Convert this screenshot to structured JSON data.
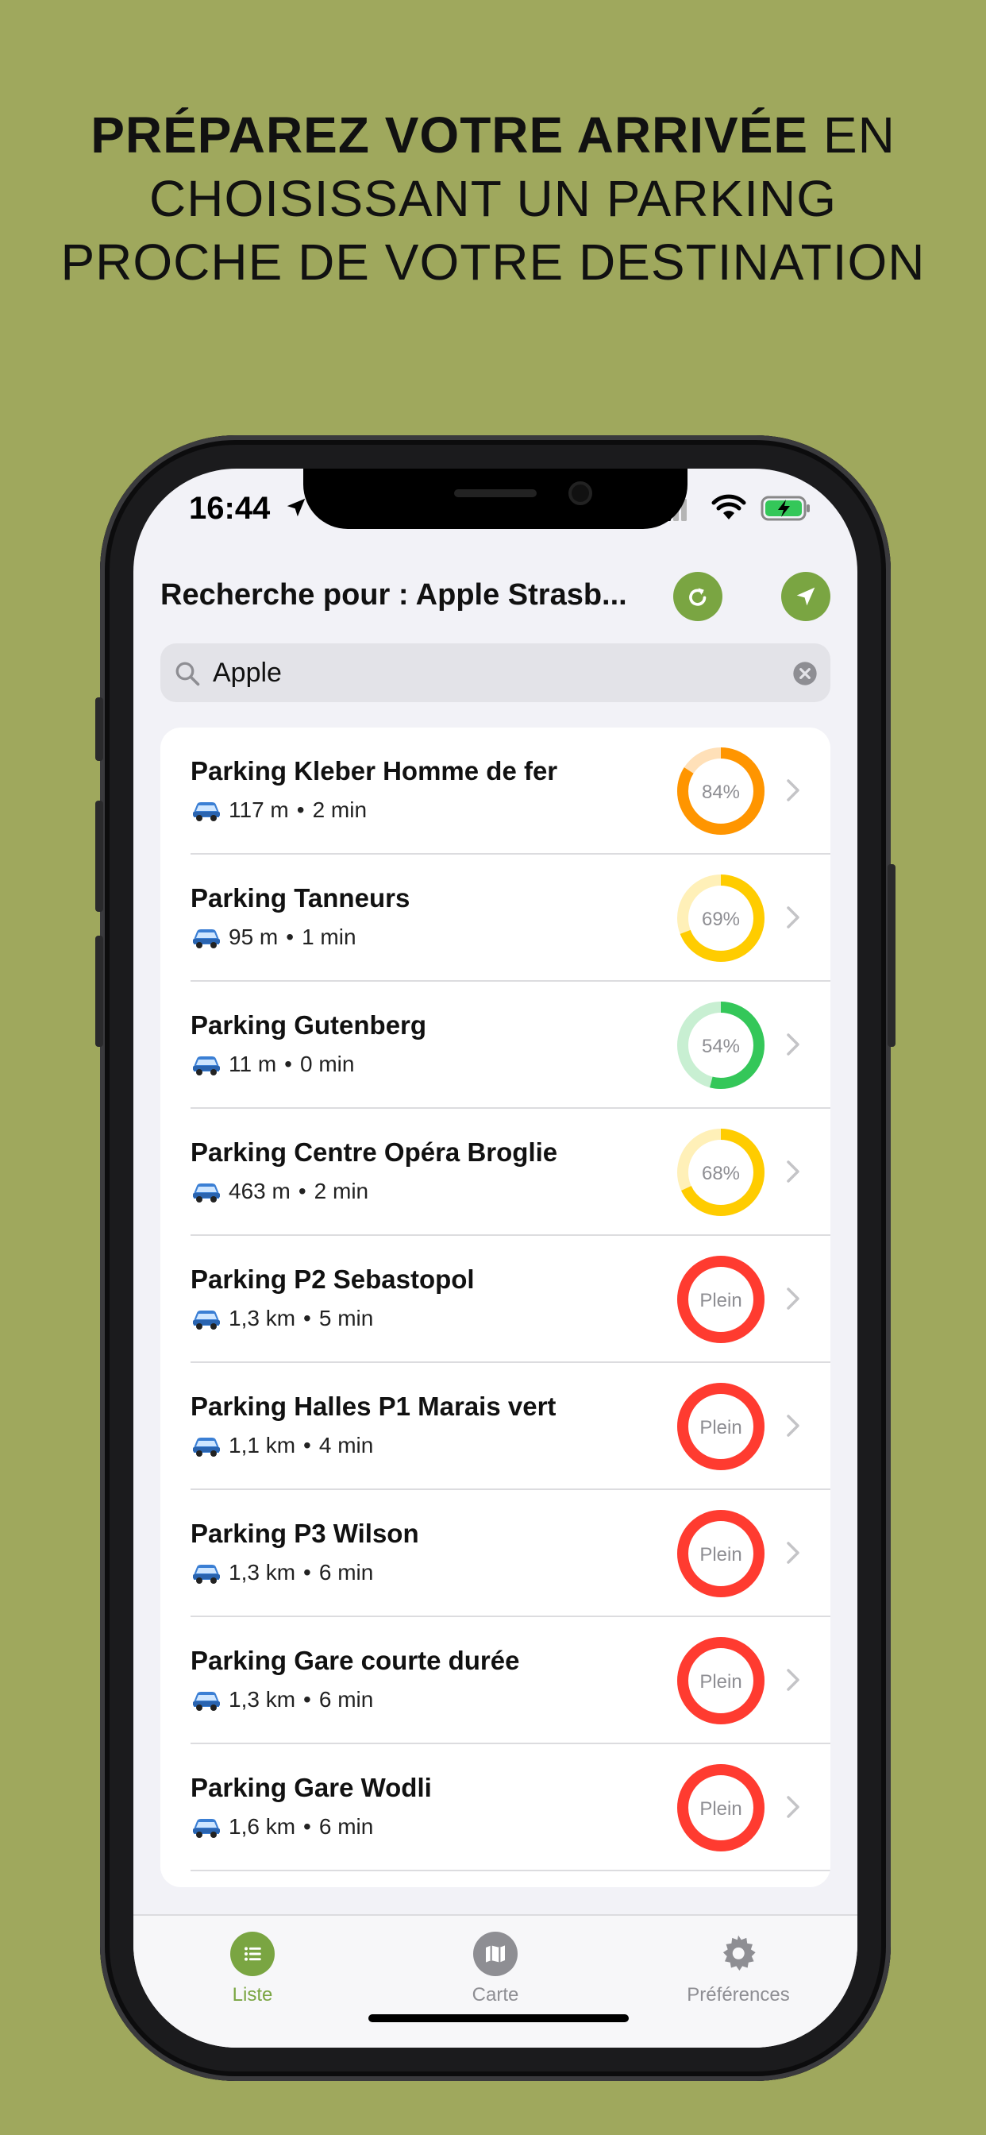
{
  "headline": {
    "bold": "PRÉPAREZ VOTRE ARRIVÉE",
    "line1_rest": " EN",
    "line2": "CHOISISSANT UN PARKING",
    "line3": "PROCHE DE VOTRE DESTINATION"
  },
  "status": {
    "time": "16:44"
  },
  "header": {
    "title": "Recherche pour : Apple Strasb..."
  },
  "search": {
    "value": "Apple"
  },
  "parkings": [
    {
      "name": "Parking Kleber Homme de fer",
      "distance": "117 m",
      "duration": "2 min",
      "label": "84%",
      "occupancy": 0.84,
      "color": "#ff9500",
      "track": "#ffe0b8"
    },
    {
      "name": "Parking Tanneurs",
      "distance": "95 m",
      "duration": "1 min",
      "label": "69%",
      "occupancy": 0.69,
      "color": "#ffcc00",
      "track": "#fff0b8"
    },
    {
      "name": "Parking Gutenberg",
      "distance": "11 m",
      "duration": "0 min",
      "label": "54%",
      "occupancy": 0.54,
      "color": "#34c759",
      "track": "#c8efd2"
    },
    {
      "name": "Parking Centre Opéra Broglie",
      "distance": "463 m",
      "duration": "2 min",
      "label": "68%",
      "occupancy": 0.68,
      "color": "#ffcc00",
      "track": "#fff0b8"
    },
    {
      "name": "Parking P2 Sebastopol",
      "distance": "1,3 km",
      "duration": "5 min",
      "label": "Plein",
      "occupancy": 1,
      "color": "#ff3b30",
      "track": "#ffc9c6"
    },
    {
      "name": "Parking Halles P1 Marais vert",
      "distance": "1,1 km",
      "duration": "4 min",
      "label": "Plein",
      "occupancy": 1,
      "color": "#ff3b30",
      "track": "#ffc9c6"
    },
    {
      "name": "Parking P3 Wilson",
      "distance": "1,3 km",
      "duration": "6 min",
      "label": "Plein",
      "occupancy": 1,
      "color": "#ff3b30",
      "track": "#ffc9c6"
    },
    {
      "name": "Parking Gare courte durée",
      "distance": "1,3 km",
      "duration": "6 min",
      "label": "Plein",
      "occupancy": 1,
      "color": "#ff3b30",
      "track": "#ffc9c6"
    },
    {
      "name": "Parking Gare Wodli",
      "distance": "1,6 km",
      "duration": "6 min",
      "label": "Plein",
      "occupancy": 1,
      "color": "#ff3b30",
      "track": "#ffc9c6"
    }
  ],
  "tabs": {
    "list": {
      "label": "Liste",
      "active": true
    },
    "map": {
      "label": "Carte",
      "active": false
    },
    "prefs": {
      "label": "Préférences",
      "active": false
    }
  },
  "colors": {
    "accent": "#7aa542",
    "inactive": "#8e8e93",
    "background": "#9fa85d"
  }
}
